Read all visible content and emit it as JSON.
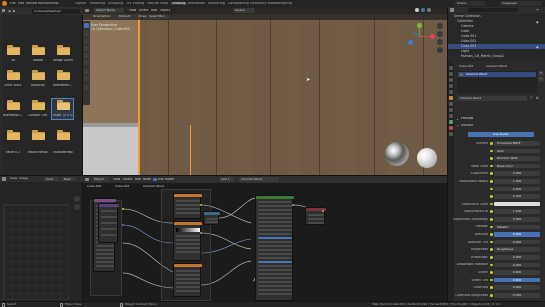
{
  "topbar": {
    "menus": [
      "File",
      "Edit",
      "Render",
      "Window",
      "Help"
    ],
    "workspaces": [
      "Layout",
      "Modeling",
      "Sculpting",
      "UV Editing",
      "Texture Paint",
      "Shading",
      "Animation",
      "Rendering",
      "Compositing",
      "Geometry Nodes",
      "Scripting"
    ],
    "active_workspace": "Shading",
    "scene": "Scene",
    "view_layer": "ViewLayer"
  },
  "file_browser": {
    "path": "C:\\Users\\Desktop\\",
    "folders": [
      {
        "name": "3D",
        "selected": false
      },
      {
        "name": "Adobe",
        "selected": false
      },
      {
        "name": "Image Dimm",
        "selected": false
      },
      {
        "name": "Arno 3D05",
        "selected": false
      },
      {
        "name": "Audacity",
        "selected": false
      },
      {
        "name": "AveMedia C...",
        "selected": false
      },
      {
        "name": "AveMedia C...",
        "selected": false
      },
      {
        "name": "Custom Offi...",
        "selected": false
      },
      {
        "name": "Duke Til 4 S...",
        "selected": true
      },
      {
        "name": "FaceFX 2",
        "selected": false
      },
      {
        "name": "Macro Recor...",
        "selected": false
      },
      {
        "name": "OutsideHelpx",
        "selected": false
      }
    ]
  },
  "viewport": {
    "header": {
      "mode": "Object Mode",
      "menus": [
        "View",
        "Select",
        "Add",
        "Object"
      ],
      "orientation": "Global"
    },
    "header2": {
      "orientation_label": "Orientation:",
      "orientation_value": "Default",
      "drag": "Drag:",
      "drag_value": "Select Box"
    },
    "info_lines": [
      "User Perspective",
      "(1) Collection | Cube.003"
    ]
  },
  "outliner": {
    "rows": [
      {
        "label": "Scene Collection",
        "selected": false
      },
      {
        "label": "Collection",
        "selected": false
      },
      {
        "label": "Camera",
        "selected": false
      },
      {
        "label": "Cube",
        "selected": false
      },
      {
        "label": "Cube.001",
        "selected": false
      },
      {
        "label": "Cube.002",
        "selected": false
      },
      {
        "label": "Cube.003",
        "selected": true
      },
      {
        "label": "Light",
        "selected": false
      },
      {
        "label": "Human_1.8_Metric_Group1",
        "selected": false
      }
    ]
  },
  "properties": {
    "object_name": "Cube.003",
    "material_name": "Charred Wood",
    "sections": [
      "Preview",
      "Surface"
    ],
    "use_nodes": "Use Nodes",
    "rows": [
      {
        "label": "Surface",
        "value": "Principled BSDF",
        "kind": "text"
      },
      {
        "label": "",
        "value": "GGX",
        "kind": "text"
      },
      {
        "label": "",
        "value": "Random Walk",
        "kind": "text"
      },
      {
        "label": "Base Color",
        "value": "Base Color",
        "kind": "text"
      },
      {
        "label": "Subsurface",
        "value": "0.000",
        "kind": "num"
      },
      {
        "label": "Subsurface Radius",
        "value": "1.000",
        "kind": "num"
      },
      {
        "label": "",
        "value": "0.200",
        "kind": "num"
      },
      {
        "label": "",
        "value": "0.100",
        "kind": "num"
      },
      {
        "label": "Subsurface Color",
        "value": "",
        "kind": "swatch"
      },
      {
        "label": "Subsurface IOR",
        "value": "1.400",
        "kind": "num"
      },
      {
        "label": "Subsurface Anisotropy",
        "value": "0.000",
        "kind": "num"
      },
      {
        "label": "Metallic",
        "value": "Metallic",
        "kind": "text"
      },
      {
        "label": "Specular",
        "value": "0.500",
        "kind": "blue"
      },
      {
        "label": "Specular Tint",
        "value": "0.000",
        "kind": "num"
      },
      {
        "label": "Roughness",
        "value": "Roughness",
        "kind": "text"
      },
      {
        "label": "Anisotropic",
        "value": "0.000",
        "kind": "num"
      },
      {
        "label": "Anisotropic Rotation",
        "value": "0.000",
        "kind": "num"
      },
      {
        "label": "Sheen",
        "value": "0.000",
        "kind": "num"
      },
      {
        "label": "Sheen Tint",
        "value": "0.500",
        "kind": "blue"
      },
      {
        "label": "Clearcoat",
        "value": "0.000",
        "kind": "num"
      },
      {
        "label": "Clearcoat Roughness",
        "value": "0.030",
        "kind": "num"
      }
    ]
  },
  "image_editor": {
    "menus": [
      "View",
      "Image"
    ],
    "mode": "View",
    "new": "New"
  },
  "node_editor": {
    "menus": [
      "Object",
      "View",
      "Select",
      "Add",
      "Node"
    ],
    "use_nodes": "Use Nodes",
    "slot": "Slot 1",
    "material": "Charred Wood",
    "breadcrumb": [
      "Cube.003",
      "Cube.003",
      "Charred Wood"
    ]
  },
  "status_bar": {
    "items": [
      "Select",
      "Move View",
      "Object Context Menu"
    ],
    "stats": "Main Build | Cube.003 | Verts:27,990 | Faces:8,584 | Tris:16,400 | Objects:1/16 | 3.1.0"
  },
  "colors": {
    "accent": "#4772b3",
    "folder": "#e3b660",
    "wood": "#6e5a45",
    "selection_orange": "#f39a2b"
  }
}
